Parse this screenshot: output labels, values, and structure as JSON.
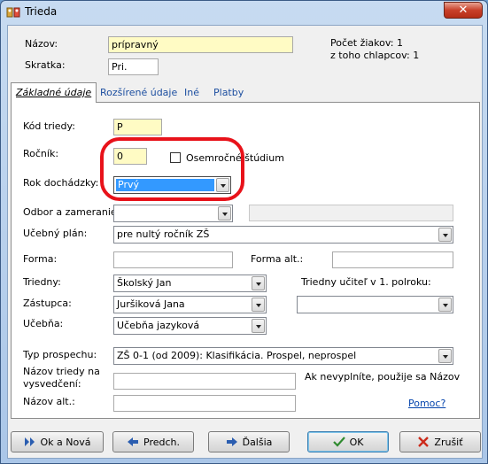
{
  "window": {
    "title": "Trieda",
    "close_label": "✕"
  },
  "header": {
    "nazov_label": "Názov:",
    "nazov_value": "prípravný",
    "skratka_label": "Skratka:",
    "skratka_value": "Pri.",
    "pocet_ziakov": "Počet žiakov: 1",
    "z_toho_chlapcov": "z toho chlapcov: 1"
  },
  "tabs": [
    {
      "label": "Základné údaje"
    },
    {
      "label": "Rozšírené údaje"
    },
    {
      "label": "Iné"
    },
    {
      "label": "Platby"
    }
  ],
  "form": {
    "kod_triedy_label": "Kód triedy:",
    "kod_triedy_value": "P",
    "rocnik_label": "Ročník:",
    "rocnik_value": "0",
    "osemrocne_label": "Osemročné štúdium",
    "rok_dochadzky_label": "Rok dochádzky:",
    "rok_dochadzky_value": "Prvý",
    "odbor_label": "Odbor a zameranie:",
    "odbor_value": "",
    "ucebny_plan_label": "Učebný plán:",
    "ucebny_plan_value": "pre nultý ročník ZŠ",
    "forma_label": "Forma:",
    "forma_value": "",
    "forma_alt_label": "Forma alt.:",
    "forma_alt_value": "",
    "triedny_label": "Triedny:",
    "triedny_value": "Školský Jan",
    "triedny_ucitel_label": "Triedny učiteľ v 1. polroku:",
    "triedny_ucitel_value": "",
    "zastupca_label": "Zástupca:",
    "zastupca_value": "Juršiková Jana",
    "ucebna_label": "Učebňa:",
    "ucebna_value": "Učebňa jazyková",
    "typ_prospechu_label": "Typ prospechu:",
    "typ_prospechu_value": "ZŠ 0-1 (od 2009): Klasifikácia. Prospel, neprospel",
    "nazov_vysvedcenie_label_1": "Názov triedy na",
    "nazov_vysvedcenie_label_2": "vysvedčení:",
    "nazov_vysvedcenie_value": "",
    "nazov_hint": "Ak nevyplníte, použije sa Názov",
    "nazov_alt_label": "Názov alt.:",
    "nazov_alt_value": "",
    "pomoc_link": "Pomoc?"
  },
  "buttons": {
    "ok_nova": "Ok a Nová",
    "predch": "Predch.",
    "dalsia": "Ďalšia",
    "ok": "OK",
    "zrusit": "Zrušiť"
  },
  "colors": {
    "highlight": "#e8121a",
    "accent": "#3399ff",
    "required_field": "#fffbc4"
  }
}
